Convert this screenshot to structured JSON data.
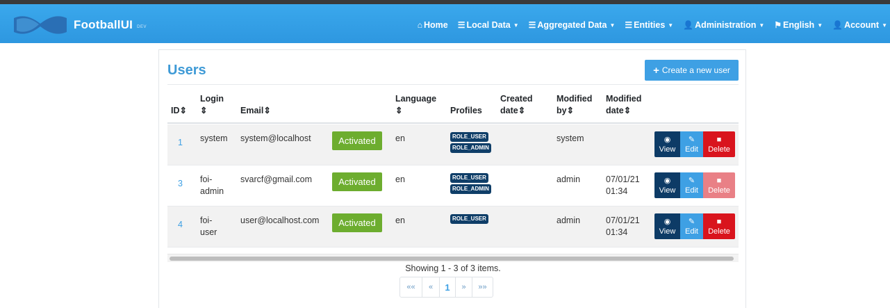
{
  "navbar": {
    "brand": "FootballUI",
    "brand_tag": "DEV",
    "items": [
      {
        "icon": "home-icon",
        "glyph": "⌂",
        "label": "Home",
        "caret": false
      },
      {
        "icon": "list-icon",
        "glyph": "☰",
        "label": "Local Data",
        "caret": true
      },
      {
        "icon": "list-icon",
        "glyph": "☰",
        "label": "Aggregated Data",
        "caret": true
      },
      {
        "icon": "list-icon",
        "glyph": "☰",
        "label": "Entities",
        "caret": true
      },
      {
        "icon": "user-plus-icon",
        "glyph": "👤",
        "label": "Administration",
        "caret": true
      },
      {
        "icon": "flag-icon",
        "glyph": "⚑",
        "label": "English",
        "caret": true
      },
      {
        "icon": "user-icon",
        "glyph": "👤",
        "label": "Account",
        "caret": true
      }
    ]
  },
  "page": {
    "title": "Users",
    "create_label": "Create a new user"
  },
  "table": {
    "headers": {
      "id": "ID",
      "login": "Login",
      "email": "Email",
      "language": "Language",
      "profiles": "Profiles",
      "created_1": "Created",
      "created_2": "date",
      "modified_by_1": "Modified",
      "modified_by_2": "by",
      "modified_date_1": "Modified",
      "modified_date_2": "date",
      "sort": "⇕"
    },
    "rows": [
      {
        "id": "1",
        "login_1": "system",
        "login_2": "",
        "email": "system@localhost",
        "status": "Activated",
        "lang": "en",
        "profiles": [
          "ROLE_USER",
          "ROLE_ADMIN"
        ],
        "created": "",
        "modified_by": "system",
        "modified_date_1": "",
        "modified_date_2": "",
        "delete_disabled": false
      },
      {
        "id": "3",
        "login_1": "foi-",
        "login_2": "admin",
        "email": "svarcf@gmail.com",
        "status": "Activated",
        "lang": "en",
        "profiles": [
          "ROLE_USER",
          "ROLE_ADMIN"
        ],
        "created": "",
        "modified_by": "admin",
        "modified_date_1": "07/01/21",
        "modified_date_2": "01:34",
        "delete_disabled": true
      },
      {
        "id": "4",
        "login_1": "foi-",
        "login_2": "user",
        "email": "user@localhost.com",
        "status": "Activated",
        "lang": "en",
        "profiles": [
          "ROLE_USER"
        ],
        "created": "",
        "modified_by": "admin",
        "modified_date_1": "07/01/21",
        "modified_date_2": "01:34",
        "delete_disabled": false
      }
    ],
    "actions": {
      "view": "View",
      "edit": "Edit",
      "delete": "Delete"
    }
  },
  "pagination": {
    "showing": "Showing 1 - 3 of 3 items.",
    "first": "««",
    "prev": "«",
    "current": "1",
    "next": "»",
    "last": "»»"
  },
  "colors": {
    "navbar": "#3aa8ec",
    "title": "#3e9ad6",
    "activated": "#6dad2f",
    "badge": "#0f3e68",
    "view": "#0d3b66",
    "edit": "#3ea0e4",
    "delete": "#d9141d"
  }
}
